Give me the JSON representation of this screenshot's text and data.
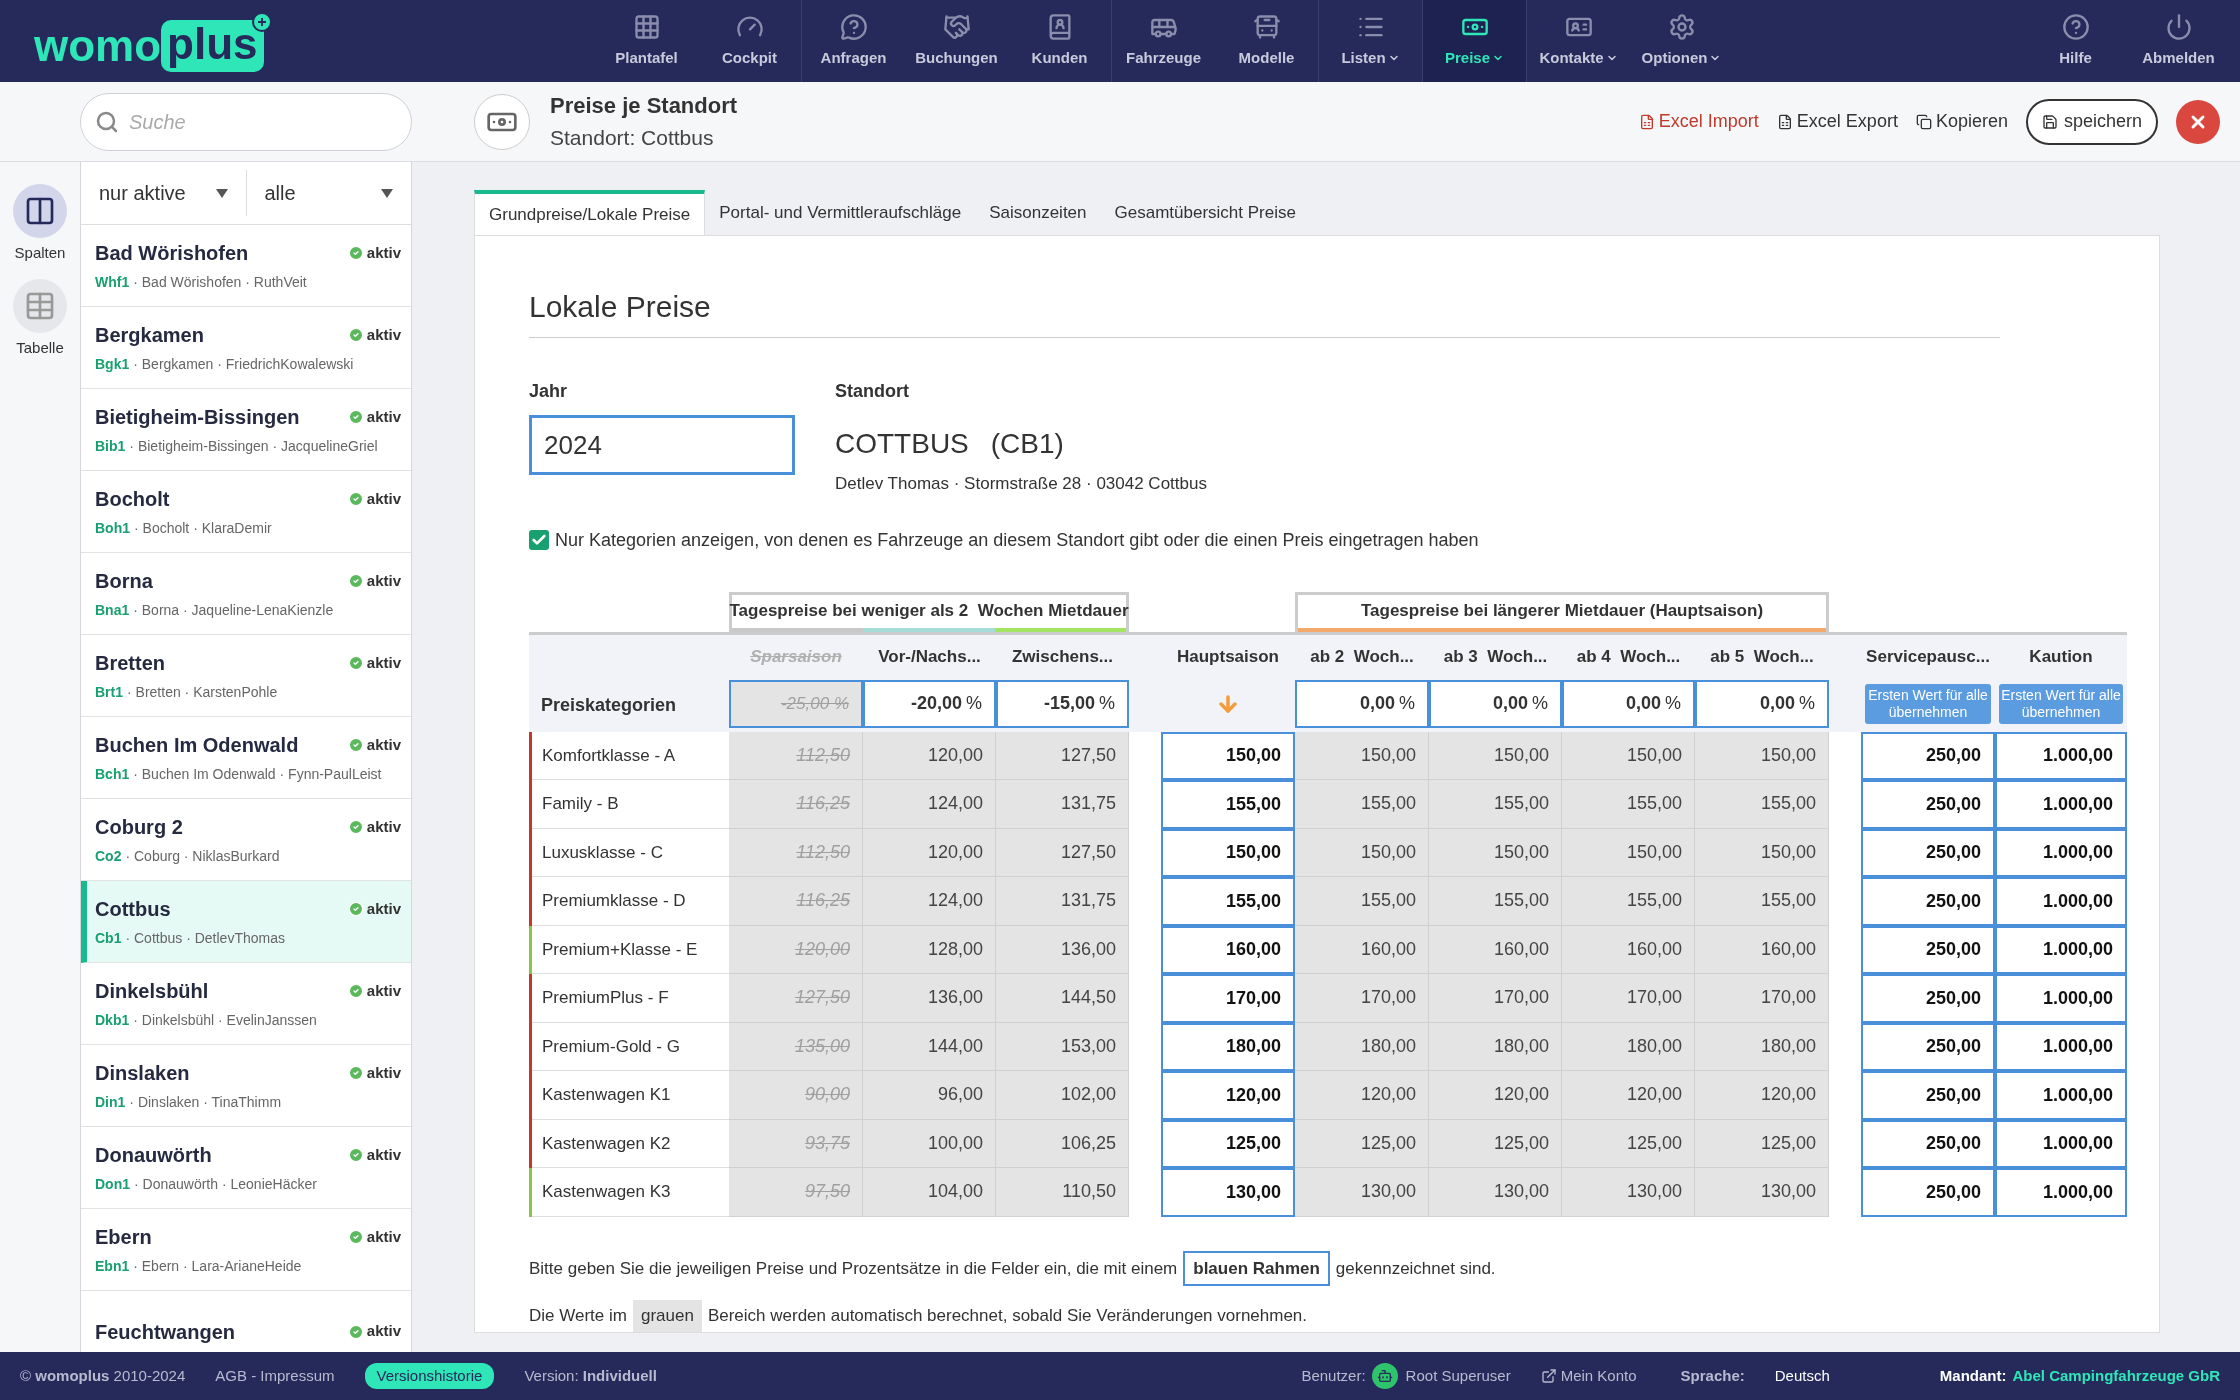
{
  "logo": {
    "part1": "womo",
    "part2": "plus"
  },
  "nav": [
    {
      "label": "Plantafel",
      "selected": false,
      "dropdown": false
    },
    {
      "label": "Cockpit",
      "selected": false,
      "dropdown": false
    },
    {
      "label": "Anfragen",
      "selected": false,
      "dropdown": false
    },
    {
      "label": "Buchungen",
      "selected": false,
      "dropdown": false
    },
    {
      "label": "Kunden",
      "selected": false,
      "dropdown": false
    },
    {
      "label": "Fahrzeuge",
      "selected": false,
      "dropdown": false
    },
    {
      "label": "Modelle",
      "selected": false,
      "dropdown": false
    },
    {
      "label": "Listen",
      "selected": false,
      "dropdown": true
    },
    {
      "label": "Preise",
      "selected": true,
      "dropdown": true
    },
    {
      "label": "Kontakte",
      "selected": false,
      "dropdown": true
    },
    {
      "label": "Optionen",
      "selected": false,
      "dropdown": true
    }
  ],
  "nav_right": [
    {
      "label": "Hilfe"
    },
    {
      "label": "Abmelden"
    }
  ],
  "search": {
    "placeholder": "Suche"
  },
  "page": {
    "title": "Preise je Standort",
    "subtitle": "Standort: Cottbus"
  },
  "actions": [
    {
      "label": "Excel Import",
      "kind": "import"
    },
    {
      "label": "Excel Export",
      "kind": "export"
    },
    {
      "label": "Kopieren",
      "kind": "copy"
    }
  ],
  "save_button": "speichern",
  "rail": [
    {
      "label": "Spalten",
      "selected": true
    },
    {
      "label": "Tabelle",
      "selected": false
    }
  ],
  "filters": [
    {
      "value": "nur aktive"
    },
    {
      "value": "alle"
    }
  ],
  "locations": [
    {
      "name": "Bad Wörishofen",
      "code": "Whf1",
      "detail": "· Bad Wörishofen · RuthVeit",
      "status": "aktiv",
      "selected": false
    },
    {
      "name": "Bergkamen",
      "code": "Bgk1",
      "detail": "· Bergkamen · FriedrichKowalewski",
      "status": "aktiv",
      "selected": false
    },
    {
      "name": "Bietigheim-Bissingen",
      "code": "Bib1",
      "detail": "· Bietigheim-Bissingen · JacquelineGriel",
      "status": "aktiv",
      "selected": false
    },
    {
      "name": "Bocholt",
      "code": "Boh1",
      "detail": "· Bocholt · KlaraDemir",
      "status": "aktiv",
      "selected": false
    },
    {
      "name": "Borna",
      "code": "Bna1",
      "detail": "· Borna · Jaqueline-LenaKienzle",
      "status": "aktiv",
      "selected": false
    },
    {
      "name": "Bretten",
      "code": "Brt1",
      "detail": "· Bretten · KarstenPohle",
      "status": "aktiv",
      "selected": false
    },
    {
      "name": "Buchen Im Odenwald",
      "code": "Bch1",
      "detail": "· Buchen Im Odenwald · Fynn-PaulLeist",
      "status": "aktiv",
      "selected": false
    },
    {
      "name": "Coburg 2",
      "code": "Co2",
      "detail": "· Coburg · NiklasBurkard",
      "status": "aktiv",
      "selected": false
    },
    {
      "name": "Cottbus",
      "code": "Cb1",
      "detail": "· Cottbus · DetlevThomas",
      "status": "aktiv",
      "selected": true
    },
    {
      "name": "Dinkelsbühl",
      "code": "Dkb1",
      "detail": "· Dinkelsbühl · EvelinJanssen",
      "status": "aktiv",
      "selected": false
    },
    {
      "name": "Dinslaken",
      "code": "Din1",
      "detail": "· Dinslaken · TinaThimm",
      "status": "aktiv",
      "selected": false
    },
    {
      "name": "Donauwörth",
      "code": "Don1",
      "detail": "· Donauwörth · LeonieHäcker",
      "status": "aktiv",
      "selected": false
    },
    {
      "name": "Ebern",
      "code": "Ebn1",
      "detail": "· Ebern · Lara-ArianeHeide",
      "status": "aktiv",
      "selected": false
    },
    {
      "name": "Feuchtwangen",
      "status": "aktiv",
      "selected": false
    }
  ],
  "tabs": [
    {
      "label": "Grundpreise/Lokale Preise",
      "selected": true
    },
    {
      "label": "Portal- und Vermittleraufschläge",
      "selected": false
    },
    {
      "label": "Saisonzeiten",
      "selected": false
    },
    {
      "label": "Gesamtübersicht Preise",
      "selected": false
    }
  ],
  "section_title": "Lokale Preise",
  "year": {
    "label": "Jahr",
    "value": "2024"
  },
  "location": {
    "label": "Standort",
    "name": "COTTBUS",
    "code": "(CB1)",
    "address": "Detlev Thomas · Stormstraße 28 · 03042 Cottbus"
  },
  "filter_checkbox": {
    "label": "Nur Kategorien anzeigen, von denen es Fahrzeuge an diesem Standort gibt oder die einen Preis eingetragen haben",
    "checked": true
  },
  "groups": [
    {
      "label": "Tagespreise bei weniger als 2  Wochen Mietdauer"
    },
    {
      "label": "Tagespreise bei längerer Mietdauer (Hauptsaison)"
    }
  ],
  "columns": [
    {
      "label": "Sparsaison",
      "kind": "struck",
      "color": "#c8c8c8"
    },
    {
      "label": "Vor-/Nachs...",
      "kind": "calc",
      "color": "#a6dcd8"
    },
    {
      "label": "Zwischens...",
      "kind": "calc",
      "color": "#a3e463"
    },
    {
      "label": "Hauptsaison",
      "kind": "input"
    },
    {
      "label": "ab 2  Woch...",
      "kind": "calc",
      "color": "#f3a96b"
    },
    {
      "label": "ab 3  Woch...",
      "kind": "calc",
      "color": "#f3a96b"
    },
    {
      "label": "ab 4  Woch...",
      "kind": "calc",
      "color": "#f3a96b"
    },
    {
      "label": "ab 5  Woch...",
      "kind": "calc",
      "color": "#f3a96b"
    },
    {
      "label": "Servicepausc...",
      "kind": "input"
    },
    {
      "label": "Kaution",
      "kind": "input"
    }
  ],
  "percent_row": {
    "label": "Preiskategorien",
    "cells": [
      {
        "kind": "struck",
        "value": "-25,00 %"
      },
      {
        "kind": "percent",
        "value": "-20,00",
        "unit": "%"
      },
      {
        "kind": "percent",
        "value": "-15,00",
        "unit": "%"
      },
      {
        "kind": "arrow"
      },
      {
        "kind": "percent",
        "value": "0,00",
        "unit": "%"
      },
      {
        "kind": "percent",
        "value": "0,00",
        "unit": "%"
      },
      {
        "kind": "percent",
        "value": "0,00",
        "unit": "%"
      },
      {
        "kind": "percent",
        "value": "0,00",
        "unit": "%"
      },
      {
        "kind": "button",
        "value": "Ersten Wert für alle übernehmen"
      },
      {
        "kind": "button",
        "value": "Ersten Wert für alle übernehmen"
      }
    ]
  },
  "rows": [
    {
      "category": "Komfortklasse - A",
      "color": "#c0392b",
      "values": [
        "112,50",
        "120,00",
        "127,50",
        "150,00",
        "150,00",
        "150,00",
        "150,00",
        "150,00",
        "250,00",
        "1.000,00"
      ]
    },
    {
      "category": "Family - B",
      "color": "#c0392b",
      "values": [
        "116,25",
        "124,00",
        "131,75",
        "155,00",
        "155,00",
        "155,00",
        "155,00",
        "155,00",
        "250,00",
        "1.000,00"
      ]
    },
    {
      "category": "Luxusklasse - C",
      "color": "#c0392b",
      "values": [
        "112,50",
        "120,00",
        "127,50",
        "150,00",
        "150,00",
        "150,00",
        "150,00",
        "150,00",
        "250,00",
        "1.000,00"
      ]
    },
    {
      "category": "Premiumklasse - D",
      "color": "#c0392b",
      "values": [
        "116,25",
        "124,00",
        "131,75",
        "155,00",
        "155,00",
        "155,00",
        "155,00",
        "155,00",
        "250,00",
        "1.000,00"
      ]
    },
    {
      "category": "Premium+Klasse - E",
      "color": "#8bc34a",
      "values": [
        "120,00",
        "128,00",
        "136,00",
        "160,00",
        "160,00",
        "160,00",
        "160,00",
        "160,00",
        "250,00",
        "1.000,00"
      ]
    },
    {
      "category": "PremiumPlus - F",
      "color": "#c0392b",
      "values": [
        "127,50",
        "136,00",
        "144,50",
        "170,00",
        "170,00",
        "170,00",
        "170,00",
        "170,00",
        "250,00",
        "1.000,00"
      ]
    },
    {
      "category": "Premium-Gold - G",
      "color": "#c0392b",
      "values": [
        "135,00",
        "144,00",
        "153,00",
        "180,00",
        "180,00",
        "180,00",
        "180,00",
        "180,00",
        "250,00",
        "1.000,00"
      ]
    },
    {
      "category": "Kastenwagen K1",
      "color": "#c0392b",
      "values": [
        "90,00",
        "96,00",
        "102,00",
        "120,00",
        "120,00",
        "120,00",
        "120,00",
        "120,00",
        "250,00",
        "1.000,00"
      ]
    },
    {
      "category": "Kastenwagen K2",
      "color": "#c0392b",
      "values": [
        "93,75",
        "100,00",
        "106,25",
        "125,00",
        "125,00",
        "125,00",
        "125,00",
        "125,00",
        "250,00",
        "1.000,00"
      ]
    },
    {
      "category": "Kastenwagen K3",
      "color": "#8bc34a",
      "values": [
        "97,50",
        "104,00",
        "110,50",
        "130,00",
        "130,00",
        "130,00",
        "130,00",
        "130,00",
        "250,00",
        "1.000,00"
      ]
    }
  ],
  "hints": [
    {
      "before": "Bitte geben Sie die jeweiligen Preise und Prozentsätze in die Felder ein, die mit einem",
      "chip": "blauen Rahmen",
      "kind": "blue",
      "after": "gekennzeichnet sind."
    },
    {
      "before": "Die Werte im",
      "chip": "grauen",
      "kind": "gray",
      "after": "Bereich werden automatisch berechnet, sobald Sie Veränderungen vornehmen."
    }
  ],
  "footer": {
    "copyright": "© **womoplus** 2010-2024",
    "legal": "AGB - Impressum",
    "history": "Versionshistorie",
    "version": "Version: **Individuell**",
    "user_label": "Benutzer:",
    "user": "Root Superuser",
    "account": "Mein Konto",
    "language_label": "Sprache:",
    "language": "Deutsch",
    "client_label": "Mandant:",
    "client": "Abel Campingfahrzeuge GbR"
  }
}
